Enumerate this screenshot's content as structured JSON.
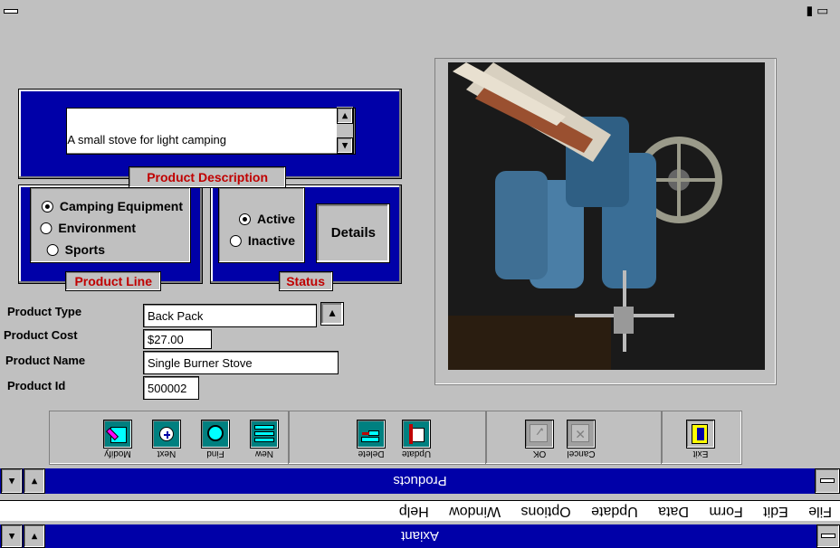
{
  "app": {
    "title": "Axiant",
    "menu": [
      "File",
      "Edit",
      "Form",
      "Data",
      "Update",
      "Options",
      "Window",
      "Help"
    ]
  },
  "form": {
    "title": "Products",
    "description_caption": "Product Description",
    "description_text": "A small stove for light camping",
    "product_line_caption": "Product Line",
    "product_line_options": [
      {
        "label": "Camping Equipment",
        "selected": true
      },
      {
        "label": "Environment",
        "selected": false
      },
      {
        "label": "Sports",
        "selected": false
      }
    ],
    "status_caption": "Status",
    "status_options": [
      {
        "label": "Active",
        "selected": true
      },
      {
        "label": "Inactive",
        "selected": false
      }
    ],
    "details_label": "Details",
    "fields": {
      "product_type_label": "Product Type",
      "product_type_value": "Back Pack",
      "product_cost_label": "Product Cost",
      "product_cost_value": "$27.00",
      "product_name_label": "Product Name",
      "product_name_value": "Single Burner Stove",
      "product_id_label": "Product Id",
      "product_id_value": "500002"
    },
    "toolbar": {
      "new": "New",
      "find": "Find",
      "next": "Next",
      "modify": "Modify",
      "update": "Update",
      "delete": "Delete",
      "ok": "OK",
      "cancel": "Cancel",
      "exit": "Exit"
    }
  },
  "colors": {
    "titlebar": "#0000a8",
    "caption_text": "#c00000",
    "face": "#c0c0c0"
  }
}
